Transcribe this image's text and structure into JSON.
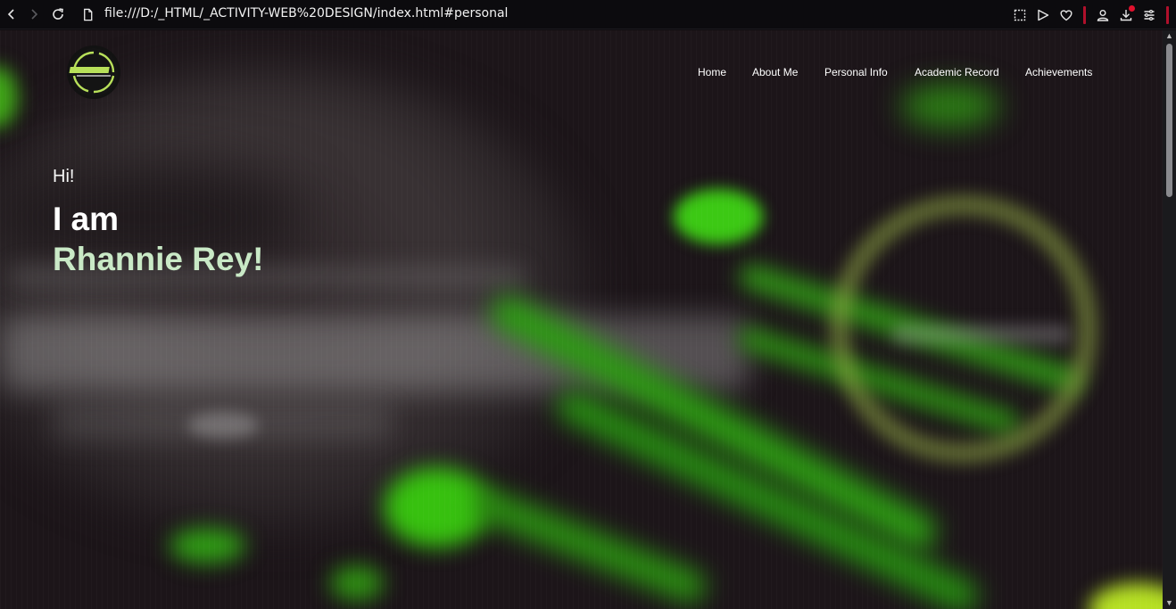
{
  "browser": {
    "url": "file:///D:/_HTML/_ACTIVITY-WEB%20DESIGN/index.html#personal",
    "icons": [
      "back-icon",
      "forward-icon",
      "reload-icon",
      "page-icon",
      "screenshot-icon",
      "send-icon",
      "heart-icon",
      "account-icon",
      "download-icon",
      "menu-icon"
    ]
  },
  "site": {
    "nav": {
      "items": [
        "Home",
        "About Me",
        "Personal Info",
        "Academic Record",
        "Achievements"
      ]
    },
    "hero": {
      "greeting": "Hi!",
      "intro": "I am",
      "name": "Rhannie Rey!"
    },
    "colors": {
      "accent_green": "#b8e05a",
      "name_color": "#c9e9c6",
      "glow_green": "#3fd21a",
      "background": "#1c1519"
    }
  }
}
